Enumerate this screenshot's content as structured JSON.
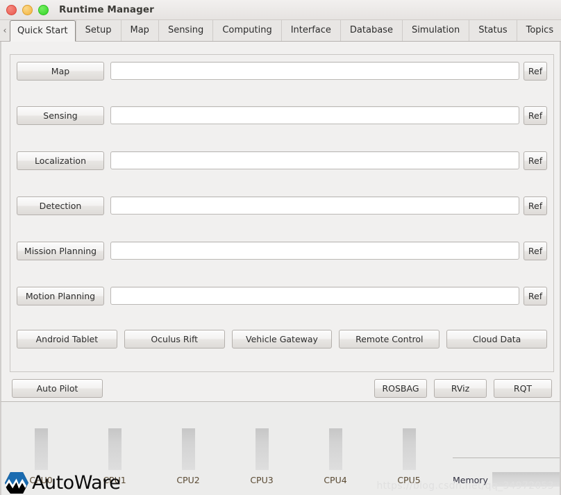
{
  "window": {
    "title": "Runtime Manager",
    "controls": [
      {
        "name": "close",
        "color": "#e9574c"
      },
      {
        "name": "minimize",
        "color": "#f2b33d"
      },
      {
        "name": "maximize",
        "color": "#32d426"
      }
    ]
  },
  "tabs": {
    "scroll_left": "‹",
    "scroll_right": "›",
    "items": [
      {
        "label": "Quick Start",
        "active": true
      },
      {
        "label": "Setup",
        "active": false
      },
      {
        "label": "Map",
        "active": false
      },
      {
        "label": "Sensing",
        "active": false
      },
      {
        "label": "Computing",
        "active": false
      },
      {
        "label": "Interface",
        "active": false
      },
      {
        "label": "Database",
        "active": false
      },
      {
        "label": "Simulation",
        "active": false
      },
      {
        "label": "Status",
        "active": false
      },
      {
        "label": "Topics",
        "active": false
      }
    ]
  },
  "quick_start": {
    "rows": [
      {
        "button": "Map",
        "value": "",
        "placeholder": "",
        "ref": "Ref"
      },
      {
        "button": "Sensing",
        "value": "",
        "placeholder": "",
        "ref": "Ref"
      },
      {
        "button": "Localization",
        "value": "",
        "placeholder": "",
        "ref": "Ref"
      },
      {
        "button": "Detection",
        "value": "",
        "placeholder": "",
        "ref": "Ref"
      },
      {
        "button": "Mission Planning",
        "value": "",
        "placeholder": "",
        "ref": "Ref"
      },
      {
        "button": "Motion Planning",
        "value": "",
        "placeholder": "",
        "ref": "Ref"
      }
    ],
    "devices": [
      "Android Tablet",
      "Oculus Rift",
      "Vehicle Gateway",
      "Remote Control",
      "Cloud Data"
    ],
    "auto_pilot": "Auto Pilot",
    "tools": [
      "ROSBAG",
      "RViz",
      "RQT"
    ]
  },
  "monitor": {
    "cpus": [
      "CPU0",
      "CPU1",
      "CPU2",
      "CPU3",
      "CPU4",
      "CPU5"
    ],
    "memory_label": "Memory"
  },
  "branding": {
    "logo_text": "AutoWare"
  },
  "watermark": "https://blog.csdn.net/qq_34972053"
}
